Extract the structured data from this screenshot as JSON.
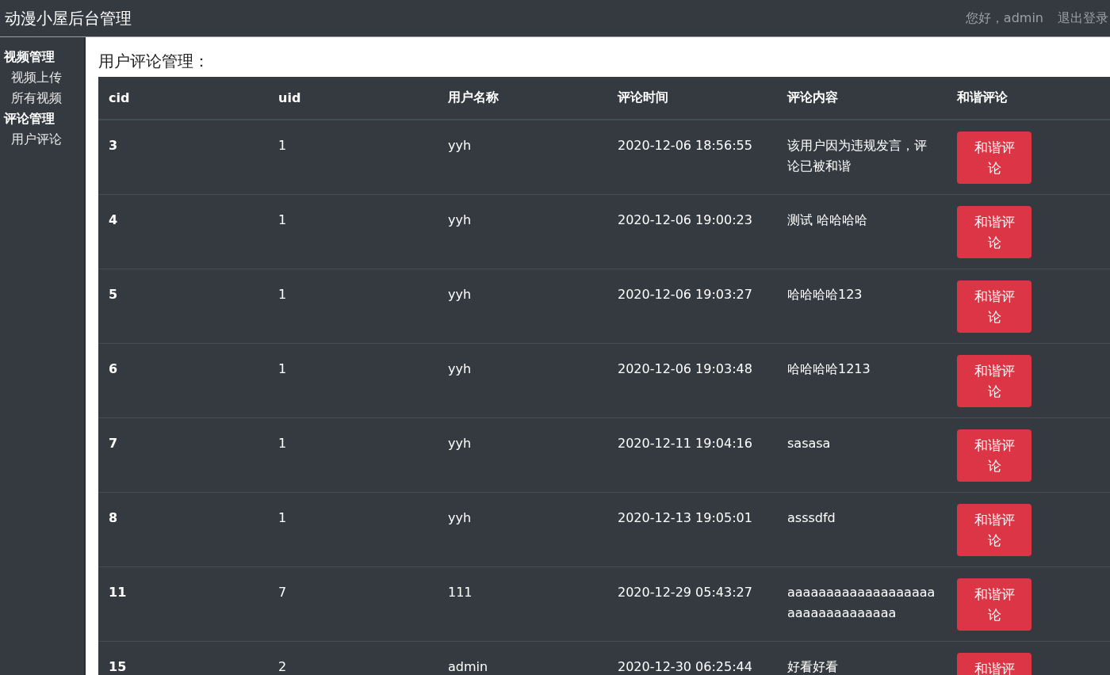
{
  "header": {
    "title": "动漫小屋后台管理",
    "greeting": "您好，admin",
    "logout": "退出登录"
  },
  "sidebar": {
    "groups": [
      {
        "title": "视频管理",
        "items": [
          "视频上传",
          "所有视频"
        ]
      },
      {
        "title": "评论管理",
        "items": [
          "用户评论"
        ]
      }
    ]
  },
  "page_title": "用户评论管理：",
  "table": {
    "columns": [
      "cid",
      "uid",
      "用户名称",
      "评论时间",
      "评论内容",
      "和谐评论"
    ],
    "rows": [
      {
        "cid": "3",
        "uid": "1",
        "user": "yyh",
        "time": "2020-12-06 18:56:55",
        "content": "该用户因为违规发言，评论已被和谐",
        "action": "和谐评论"
      },
      {
        "cid": "4",
        "uid": "1",
        "user": "yyh",
        "time": "2020-12-06 19:00:23",
        "content": "测试 哈哈哈哈",
        "action": "和谐评论"
      },
      {
        "cid": "5",
        "uid": "1",
        "user": "yyh",
        "time": "2020-12-06 19:03:27",
        "content": "哈哈哈哈123",
        "action": "和谐评论"
      },
      {
        "cid": "6",
        "uid": "1",
        "user": "yyh",
        "time": "2020-12-06 19:03:48",
        "content": "哈哈哈哈1213",
        "action": "和谐评论"
      },
      {
        "cid": "7",
        "uid": "1",
        "user": "yyh",
        "time": "2020-12-11 19:04:16",
        "content": "sasasa",
        "action": "和谐评论"
      },
      {
        "cid": "8",
        "uid": "1",
        "user": "yyh",
        "time": "2020-12-13 19:05:01",
        "content": "asssdfd",
        "action": "和谐评论"
      },
      {
        "cid": "11",
        "uid": "7",
        "user": "111",
        "time": "2020-12-29 05:43:27",
        "content": "aaaaaaaaaaaaaaaaaaaaaaaaaaaaaaaaa",
        "action": "和谐评论"
      },
      {
        "cid": "15",
        "uid": "2",
        "user": "admin",
        "time": "2020-12-30 06:25:44",
        "content": "好看好看",
        "action": "和谐评"
      }
    ]
  }
}
